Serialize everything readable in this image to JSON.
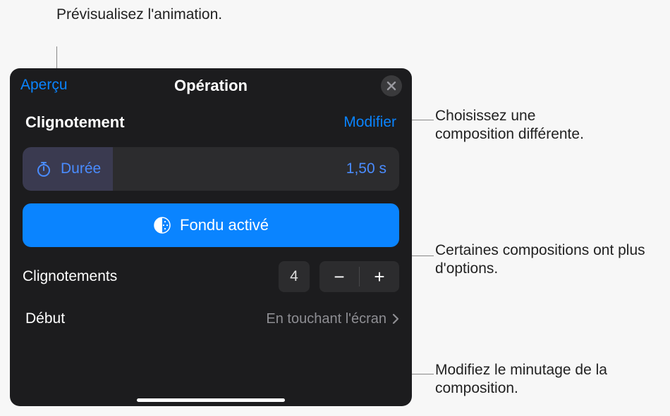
{
  "callouts": {
    "preview": "Prévisualisez l'animation.",
    "modify": "Choisissez une composition différente.",
    "fade": "Certaines compositions ont plus d'options.",
    "start": "Modifiez le minutage de la composition."
  },
  "panel": {
    "title": "Opération",
    "preview_button": "Aperçu"
  },
  "effect": {
    "name": "Clignotement",
    "modify_label": "Modifier"
  },
  "duration": {
    "label": "Durée",
    "value": "1,50 s"
  },
  "fade": {
    "label": "Fondu activé"
  },
  "blinks": {
    "label": "Clignotements",
    "value": "4"
  },
  "start": {
    "label": "Début",
    "value": "En touchant l'écran"
  }
}
